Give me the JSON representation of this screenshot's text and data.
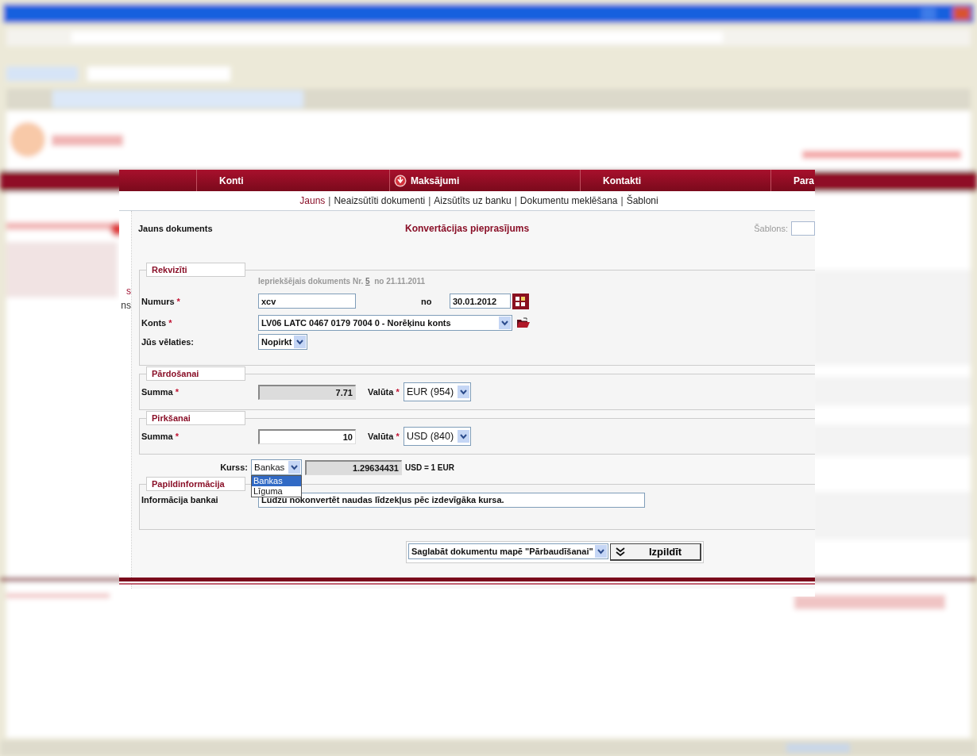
{
  "sidebar_fragments": [
    {
      "text": "s",
      "selected": true
    },
    {
      "text": "ns",
      "selected": false
    }
  ],
  "nav": [
    {
      "label": "Konti",
      "icon": false
    },
    {
      "label": "Maksājumi",
      "icon": true
    },
    {
      "label": "Kontakti",
      "icon": false
    },
    {
      "label": "Para",
      "icon": false
    }
  ],
  "subnav": [
    {
      "label": "Jauns",
      "selected": true
    },
    {
      "separator": "|",
      "label": "Neaizsūtīti dokumenti",
      "selected": false
    },
    {
      "separator": "|",
      "label": "Aizsūtīts uz banku",
      "selected": false
    },
    {
      "separator": "|",
      "label": "Dokumentu meklēšana",
      "selected": false
    },
    {
      "separator": "|",
      "label": "Šabloni",
      "selected": false
    }
  ],
  "header": {
    "left": "Jauns dokuments",
    "title": "Konvertācijas pieprasījums",
    "template_label": "Šablons:"
  },
  "details": {
    "legend": "Rekvizīti",
    "previous_prefix": "Iepriekšējais dokuments Nr.",
    "previous_link": "5",
    "previous_suffix": "no 21.11.2011",
    "number_label": "Numurs",
    "number_mark": "*",
    "number": "xcv",
    "date_label": "no",
    "date": "30.01.2012",
    "account_label": "Konts",
    "account_mark": "*",
    "account": "LV06 LATC 0467 0179 7004 0 - Norēķinu konts",
    "action_label": "Jūs vēlaties:",
    "action": "Nopirkt"
  },
  "sell": {
    "legend": "Pārdošanai",
    "amount_label": "Summa",
    "amount_mark": "*",
    "amount": "7.71",
    "readonly": true,
    "currency_label": "Valūta",
    "currency_mark": "*",
    "currency": "EUR (954)"
  },
  "buy": {
    "legend": "Pirkšanai",
    "amount_label": "Summa",
    "amount_mark": "*",
    "amount": "10",
    "readonly": false,
    "currency_label": "Valūta",
    "currency_mark": "*",
    "currency": "USD (840)"
  },
  "rate": {
    "label": "Kurss:",
    "value": "Bankas",
    "expanded": true,
    "options": [
      {
        "label": "Bankas",
        "selected": true
      },
      {
        "label": "Līguma",
        "selected": false
      }
    ],
    "rate": "1.29634431",
    "unit": "USD = 1 EUR"
  },
  "info": {
    "legend": "Papildinformācija",
    "label": "Informācija bankai",
    "value": "Lūdzu nokonvertēt naudas līdzekļus pēc izdevīgāka kursa."
  },
  "footer": {
    "save_option": "Saglabāt dokumentu mapē \"Pārbaudīšanai\"",
    "submit": "Izpildīt"
  }
}
